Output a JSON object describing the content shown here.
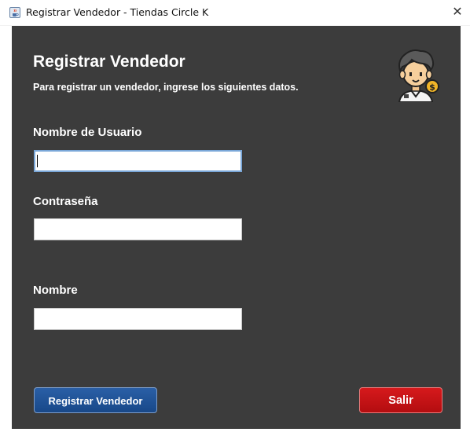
{
  "window": {
    "title": "Registrar Vendedor - Tiendas Circle K",
    "close_glyph": "✕"
  },
  "header": {
    "title": "Registrar Vendedor",
    "subtitle": "Para registrar un vendedor, ingrese los siguientes datos."
  },
  "form": {
    "username": {
      "label": "Nombre de Usuario",
      "value": ""
    },
    "password": {
      "label": "Contraseña",
      "value": ""
    },
    "name": {
      "label": "Nombre",
      "value": ""
    }
  },
  "buttons": {
    "register_label": "Registrar Vendedor",
    "exit_label": "Salir"
  },
  "icons": {
    "app_icon": "java-cup-icon",
    "avatar": "seller-avatar-icon"
  },
  "colors": {
    "panel_background": "#3c3c3c",
    "register_button": "#1f4f94",
    "exit_button": "#c81215",
    "text": "#ffffff"
  }
}
